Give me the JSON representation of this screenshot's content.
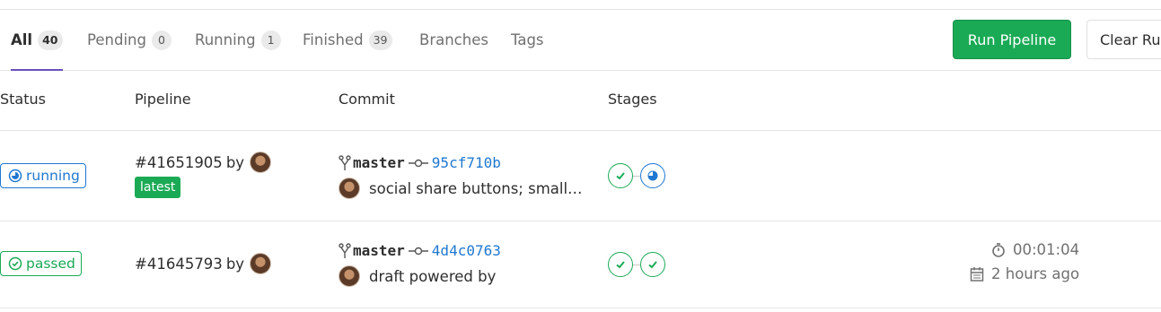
{
  "tabs": [
    {
      "label": "All",
      "count": "40",
      "active": true
    },
    {
      "label": "Pending",
      "count": "0"
    },
    {
      "label": "Running",
      "count": "1"
    },
    {
      "label": "Finished",
      "count": "39"
    },
    {
      "label": "Branches"
    },
    {
      "label": "Tags"
    }
  ],
  "actions": {
    "run_pipeline": "Run Pipeline",
    "clear_runner_caches": "Clear Ru"
  },
  "columns": {
    "status": "Status",
    "pipeline": "Pipeline",
    "commit": "Commit",
    "stages": "Stages"
  },
  "pipelines": [
    {
      "status": "running",
      "id": "#41651905",
      "by": "by",
      "tag": "latest",
      "branch": "master",
      "sha": "95cf710b",
      "title": "social share buttons; small…",
      "stages": [
        "passed",
        "running"
      ],
      "duration": "",
      "finished": ""
    },
    {
      "status": "passed",
      "id": "#41645793",
      "by": "by",
      "tag": "",
      "branch": "master",
      "sha": "4d4c0763",
      "title": "draft powered by",
      "stages": [
        "passed",
        "passed"
      ],
      "duration": "00:01:04",
      "finished": "2 hours ago"
    }
  ],
  "colors": {
    "accent": "#6b4fbb",
    "success": "#1aaa55",
    "running": "#1f78d1",
    "muted": "#707070",
    "border": "#e5e5e5"
  },
  "icons": {
    "status_running": "running-icon",
    "status_passed": "check-circle-icon",
    "branch": "branch-icon",
    "commit": "commit-icon",
    "duration": "stopwatch-icon",
    "finished": "calendar-icon"
  }
}
